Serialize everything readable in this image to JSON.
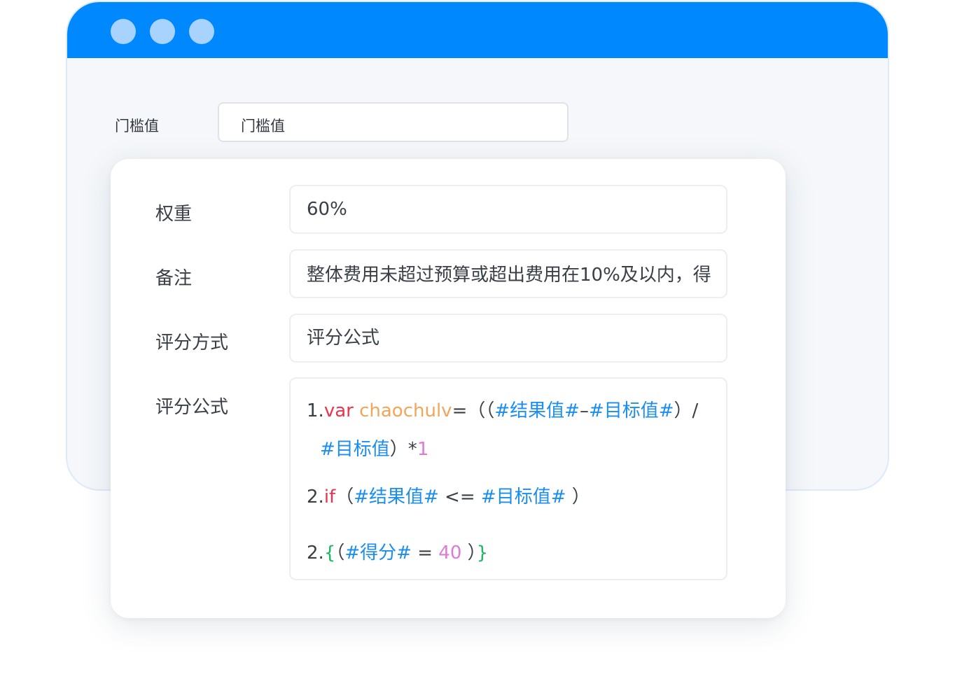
{
  "window": {
    "traffic_lights": [
      "window-dot-1",
      "window-dot-2",
      "window-dot-3"
    ],
    "titlebar_color": "#0088ff"
  },
  "threshold": {
    "label": "门槛值",
    "value": "门槛值"
  },
  "form": {
    "weight": {
      "label": "权重",
      "value": "60%"
    },
    "remark": {
      "label": "备注",
      "value": "整体费用未超过预算或超出费用在10%及以内，得"
    },
    "scoring_method": {
      "label": "评分方式",
      "value": "评分公式"
    },
    "formula": {
      "label": "评分公式",
      "line1": {
        "prefix": "1.",
        "keyword": "var",
        "space": " ",
        "variable": "chaochulv",
        "op1": "=（（",
        "result_token": "#结果值#",
        "minus": "–",
        "target_token": "#目标值#",
        "close_div": "）/"
      },
      "line1b": {
        "target_token": "#目标值",
        "close_mult": "）*",
        "number": "1"
      },
      "line2": {
        "prefix": "2.",
        "keyword": "if",
        "open": "（",
        "result_token": "#结果值#",
        "compare": " <= ",
        "target_token": "#目标值#",
        "close": " ）"
      },
      "line3": {
        "prefix": "2.",
        "brace_open": "{",
        "open": "（",
        "score_token": "#得分#",
        "equals": " = ",
        "number": "40",
        "close": " ）",
        "brace_close": "}"
      }
    }
  },
  "colors": {
    "keyword": "#e8344e",
    "variable": "#f2a65a",
    "token": "#1a8ef0",
    "number": "#e07ad6",
    "brace": "#1fb563"
  }
}
